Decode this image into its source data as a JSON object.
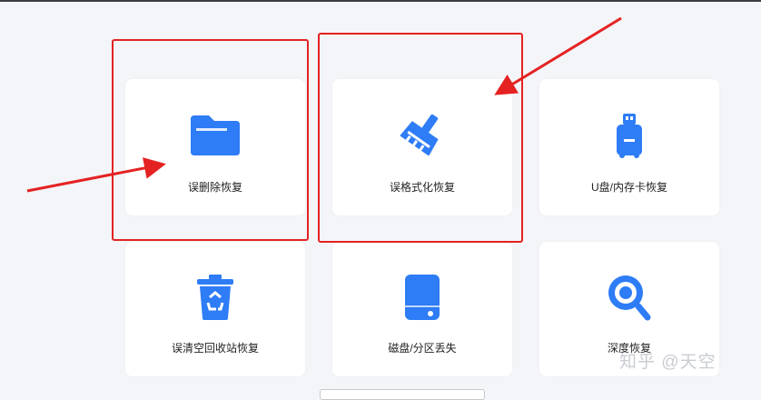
{
  "options": [
    {
      "label": "误删除恢复",
      "icon": "folder-icon"
    },
    {
      "label": "误格式化恢复",
      "icon": "broom-icon"
    },
    {
      "label": "U盘/内存卡恢复",
      "icon": "usb-drive-icon"
    },
    {
      "label": "误清空回收站恢复",
      "icon": "recycle-bin-icon"
    },
    {
      "label": "磁盘/分区丢失",
      "icon": "hard-disk-icon"
    },
    {
      "label": "深度恢复",
      "icon": "deep-scan-icon"
    }
  ],
  "watermark": "知乎 @天空",
  "colors": {
    "accent": "#2e7cf6",
    "highlight": "#e42222",
    "background": "#f4f5f8"
  }
}
